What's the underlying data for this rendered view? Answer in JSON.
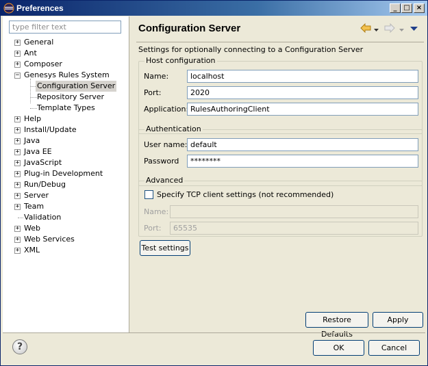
{
  "window": {
    "title": "Preferences"
  },
  "filter": {
    "placeholder": "type filter text"
  },
  "tree": [
    {
      "label": "General",
      "expander": "+"
    },
    {
      "label": "Ant",
      "expander": "+"
    },
    {
      "label": "Composer",
      "expander": "+"
    },
    {
      "label": "Genesys Rules System",
      "expander": "−"
    },
    {
      "label": "Configuration Server",
      "expander": ""
    },
    {
      "label": "Repository Server",
      "expander": ""
    },
    {
      "label": "Template Types",
      "expander": ""
    },
    {
      "label": "Help",
      "expander": "+"
    },
    {
      "label": "Install/Update",
      "expander": "+"
    },
    {
      "label": "Java",
      "expander": "+"
    },
    {
      "label": "Java EE",
      "expander": "+"
    },
    {
      "label": "JavaScript",
      "expander": "+"
    },
    {
      "label": "Plug-in Development",
      "expander": "+"
    },
    {
      "label": "Run/Debug",
      "expander": "+"
    },
    {
      "label": "Server",
      "expander": "+"
    },
    {
      "label": "Team",
      "expander": "+"
    },
    {
      "label": "Validation",
      "expander": ""
    },
    {
      "label": "Web",
      "expander": "+"
    },
    {
      "label": "Web Services",
      "expander": "+"
    },
    {
      "label": "XML",
      "expander": "+"
    }
  ],
  "page": {
    "title": "Configuration Server",
    "description": "Settings for optionally connecting to a Configuration Server",
    "host": {
      "title": "Host configuration",
      "name_label": "Name:",
      "name_value": "localhost",
      "port_label": "Port:",
      "port_value": "2020",
      "app_label": "Application:",
      "app_value": "RulesAuthoringClient"
    },
    "auth": {
      "title": "Authentication",
      "user_label": "User name:",
      "user_value": "default",
      "password_label": "Password",
      "password_value": "********"
    },
    "advanced": {
      "title": "Advanced",
      "checkbox_label": "Specify TCP client settings (not recommended)",
      "checked": false,
      "name_label": "Name:",
      "name_value": "",
      "port_label": "Port:",
      "port_value": "65535"
    },
    "test_button": "Test settings",
    "restore_button": "Restore Defaults",
    "apply_button": "Apply"
  },
  "footer": {
    "ok": "OK",
    "cancel": "Cancel",
    "help": "?"
  },
  "colors": {
    "accent": "#0a246a",
    "nav_arrow": "#e8a317"
  }
}
